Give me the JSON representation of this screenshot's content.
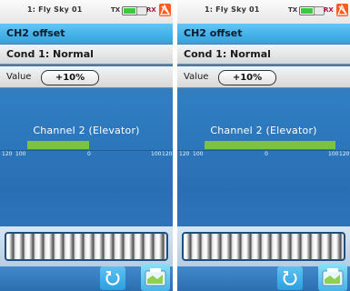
{
  "screens": [
    {
      "status": {
        "model_name": "1: Fly Sky 01",
        "tx_label": "TX",
        "rx_label": "RX"
      },
      "title": "CH2 offset",
      "condition": "Cond 1: Normal",
      "value_label": "Value",
      "value": "+10%",
      "channel_label": "Channel 2 (Elevator)",
      "channel_bar_fill_percent": 45,
      "scale_ticks": [
        "120",
        "100",
        "0",
        "100",
        "120"
      ]
    },
    {
      "status": {
        "model_name": "1: Fly Sky 01",
        "tx_label": "TX",
        "rx_label": "RX"
      },
      "title": "CH2 offset",
      "condition": "Cond 1: Normal",
      "value_label": "Value",
      "value": "+10%",
      "channel_label": "Channel 2 (Elevator)",
      "channel_bar_fill_percent": 96,
      "scale_ticks": [
        "120",
        "100",
        "0",
        "100",
        "120"
      ]
    }
  ],
  "colors": {
    "title_bar": "#2fa4e2",
    "background": "#2f7dc2",
    "channel_bar": "#7dc242",
    "signal_warning": "#ff5a1f"
  },
  "icons": {
    "back": "back-arrow-icon",
    "save": "save-icon",
    "battery": "battery-icon",
    "signal": "signal-warning-icon"
  }
}
